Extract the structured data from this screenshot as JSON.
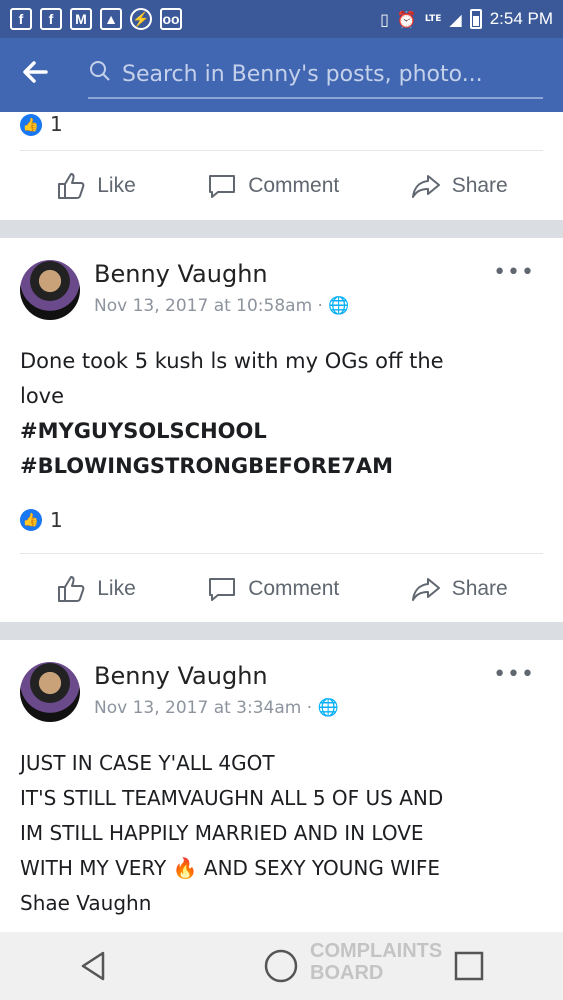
{
  "status": {
    "time": "2:54 PM",
    "network": "LTE",
    "icons": [
      "facebook-icon",
      "facebook-icon",
      "gmail-icon",
      "gallery-icon",
      "messenger-icon",
      "voicemail-icon"
    ]
  },
  "header": {
    "search_placeholder": "Search in Benny's posts, photo..."
  },
  "top_card": {
    "reaction_count": "1",
    "actions": {
      "like": "Like",
      "comment": "Comment",
      "share": "Share"
    }
  },
  "posts": [
    {
      "author": "Benny Vaughn",
      "timestamp": "Nov 13, 2017 at 10:58am",
      "text_lines": [
        "Done took 5  kush ls with my OGs off the",
        "love"
      ],
      "hashtags": [
        "#MYGUYSOLSCHOOL",
        "#BLOWINGSTRONGBEFORE7AM"
      ],
      "reaction_count": "1",
      "actions": {
        "like": "Like",
        "comment": "Comment",
        "share": "Share"
      }
    },
    {
      "author": "Benny Vaughn",
      "timestamp": "Nov 13, 2017 at 3:34am",
      "text_lines": [
        "JUST IN CASE Y'ALL 4GOT",
        "IT'S STILL TEAMVAUGHN ALL 5 OF US AND",
        "IM STILL HAPPILY MARRIED AND IN LOVE",
        "WITH MY VERY",
        "AND SEXY YOUNG WIFE",
        "Shae Vaughn"
      ]
    }
  ],
  "watermark": "COMPLAINTS BOARD",
  "colors": {
    "fb_blue": "#4267b2",
    "status_bar": "#3b5998"
  }
}
